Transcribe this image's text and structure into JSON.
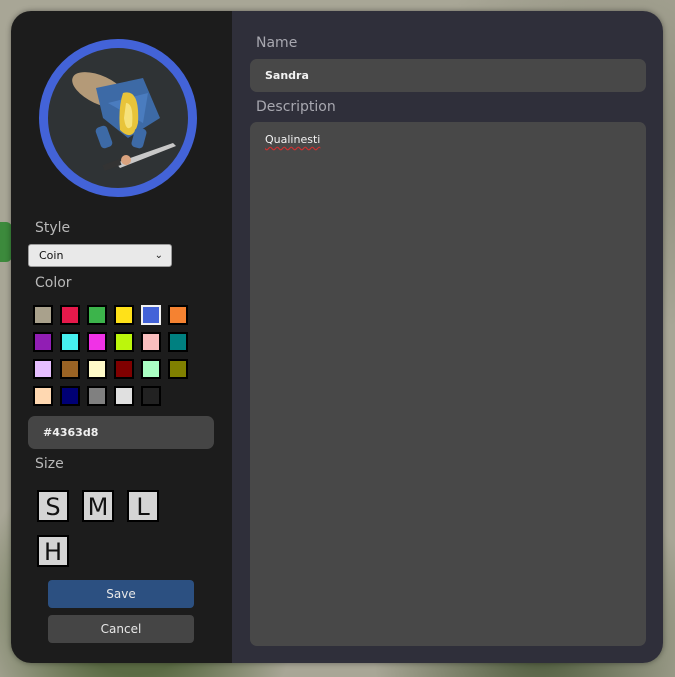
{
  "token": {
    "border_color": "#4363d8",
    "image_alt": "Top-down token of a blond warrior in blue armor with a sword"
  },
  "style": {
    "label": "Style",
    "selected": "Coin",
    "chevron_icon": "chevron-down-icon"
  },
  "color": {
    "label": "Color",
    "selected_index": 4,
    "swatches": [
      "#a9a18c",
      "#e6194b",
      "#3cb44b",
      "#ffe119",
      "#4363d8",
      "#f58231",
      "#911eb4",
      "#46f0f0",
      "#f032e6",
      "#bcf60c",
      "#fabebe",
      "#008080",
      "#e6beff",
      "#9a6324",
      "#fffac8",
      "#800000",
      "#aaffc3",
      "#808000",
      "#ffd8b1",
      "#000075",
      "#808080",
      "#e0e0e0",
      "#222222"
    ],
    "hex_value": "#4363d8"
  },
  "size": {
    "label": "Size",
    "options": [
      "S",
      "M",
      "L",
      "H"
    ]
  },
  "buttons": {
    "save": "Save",
    "cancel": "Cancel"
  },
  "fields": {
    "name_label": "Name",
    "name_value": "Sandra",
    "description_label": "Description",
    "description_value": "Qualinesti"
  }
}
